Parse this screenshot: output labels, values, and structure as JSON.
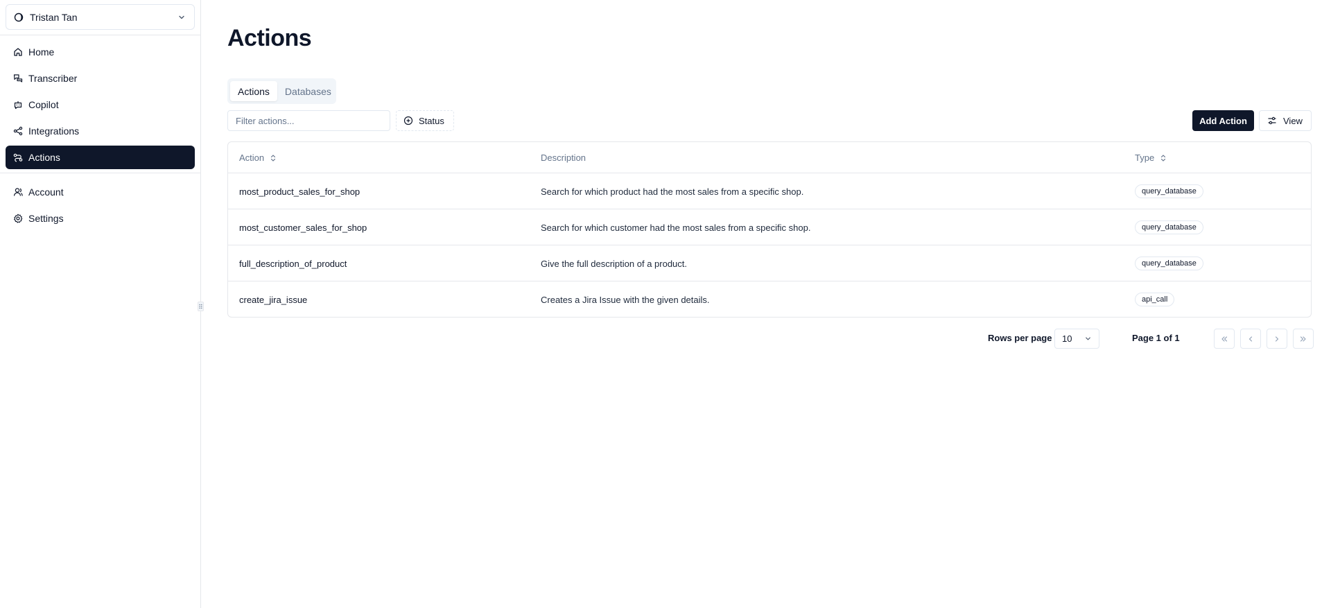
{
  "sidebar": {
    "user": {
      "name": "Tristan Tan"
    },
    "nav": [
      {
        "label": "Home",
        "icon": "home-icon"
      },
      {
        "label": "Transcriber",
        "icon": "transcriber-icon"
      },
      {
        "label": "Copilot",
        "icon": "bot-icon"
      },
      {
        "label": "Integrations",
        "icon": "share-icon"
      },
      {
        "label": "Actions",
        "icon": "route-icon",
        "active": true
      }
    ],
    "nav_secondary": [
      {
        "label": "Account",
        "icon": "user-icon"
      },
      {
        "label": "Settings",
        "icon": "gear-icon"
      }
    ]
  },
  "main": {
    "title": "Actions",
    "tabs": [
      {
        "label": "Actions",
        "active": true
      },
      {
        "label": "Databases",
        "active": false
      }
    ],
    "filter": {
      "placeholder": "Filter actions...",
      "value": ""
    },
    "status_button": "Status",
    "add_button": "Add Action",
    "view_button": "View"
  },
  "table": {
    "headers": {
      "action": "Action",
      "description": "Description",
      "type": "Type"
    },
    "rows": [
      {
        "action": "most_product_sales_for_shop",
        "description": "Search for which product had the most sales from a specific shop.",
        "type": "query_database"
      },
      {
        "action": "most_customer_sales_for_shop",
        "description": "Search for which customer had the most sales from a specific shop.",
        "type": "query_database"
      },
      {
        "action": "full_description_of_product",
        "description": "Give the full description of a product.",
        "type": "query_database"
      },
      {
        "action": "create_jira_issue",
        "description": "Creates a Jira Issue with the given details.",
        "type": "api_call"
      }
    ]
  },
  "pagination": {
    "rows_per_page_label": "Rows per page",
    "rows_per_page_value": "10",
    "page_info": "Page 1 of 1"
  },
  "colors": {
    "primary": "#0f172a",
    "border": "#e5e7eb",
    "muted": "#64748b",
    "tab_bg": "#f1f5f9"
  }
}
